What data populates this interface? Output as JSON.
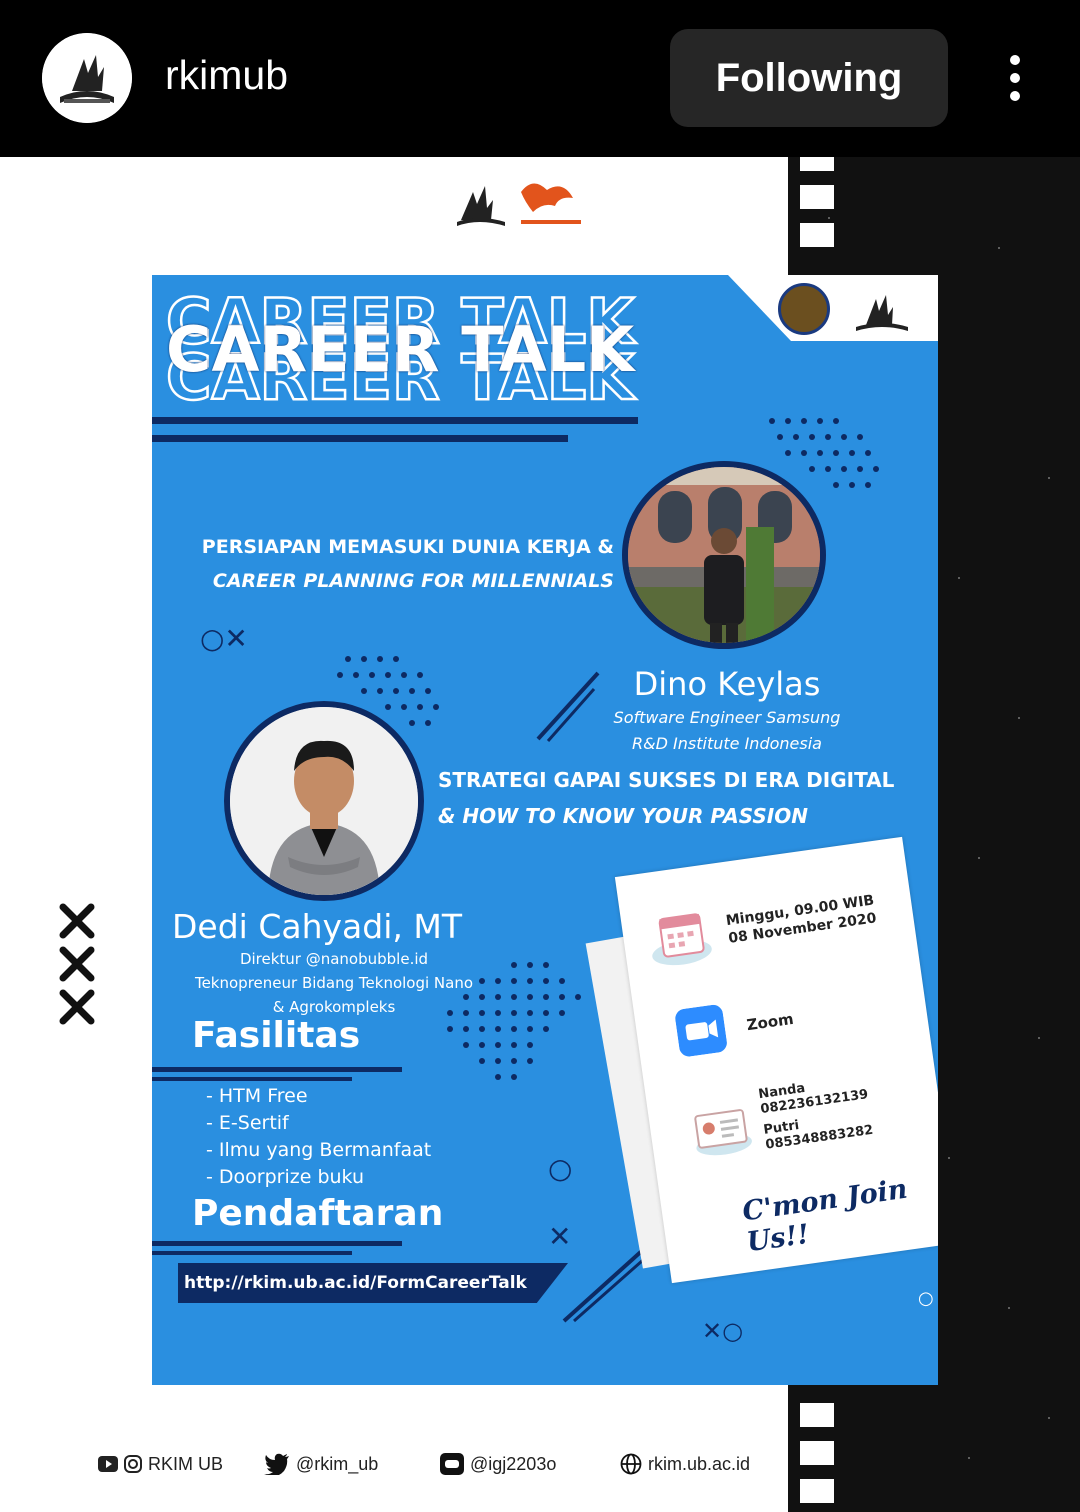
{
  "header": {
    "username": "rkimub",
    "follow_label": "Following",
    "avatar_icon": "rkim-logo-icon",
    "more_icon": "more-options-icon"
  },
  "poster": {
    "title": "CAREER TALK",
    "session1": {
      "topic_line1": "PERSIAPAN MEMASUKI DUNIA KERJA &",
      "topic_line2": "CAREER PLANNING FOR MILLENNIALS",
      "speaker_name": "Dino Keylas",
      "speaker_role_line1": "Software Engineer Samsung",
      "speaker_role_line2": "R&D Institute Indonesia"
    },
    "session2": {
      "topic_line1": "STRATEGI GAPAI SUKSES DI ERA DIGITAL",
      "topic_line2": "& HOW TO KNOW YOUR PASSION",
      "speaker_name": "Dedi Cahyadi, MT",
      "speaker_role_line1": "Direktur @nanobubble.id",
      "speaker_role_line2": "Teknopreneur Bidang Teknologi Nano",
      "speaker_role_line3": "& Agrokompleks"
    },
    "facilities": {
      "heading": "Fasilitas",
      "items": [
        "- HTM Free",
        "- E-Sertif",
        "- Ilmu yang Bermanfaat",
        "- Doorprize buku"
      ]
    },
    "registration": {
      "heading": "Pendaftaran",
      "url": "http://rkim.ub.ac.id/FormCareerTalk"
    },
    "info_card": {
      "date_line1": "Minggu, 09.00 WIB",
      "date_line2": "08 November 2020",
      "platform": "Zoom",
      "contact1_name": "Nanda",
      "contact1_phone": "082236132139",
      "contact2_name": "Putri",
      "contact2_phone": "085348883282",
      "cta": "C'mon Join Us!!"
    }
  },
  "footer": {
    "youtube_instagram": "RKIM UB",
    "twitter": "@rkim_ub",
    "line": "@igj2203o",
    "website": "rkim.ub.ac.id"
  },
  "colors": {
    "poster_blue": "#2a8fe0",
    "navy": "#0d2a63",
    "button_bg": "#262626"
  }
}
